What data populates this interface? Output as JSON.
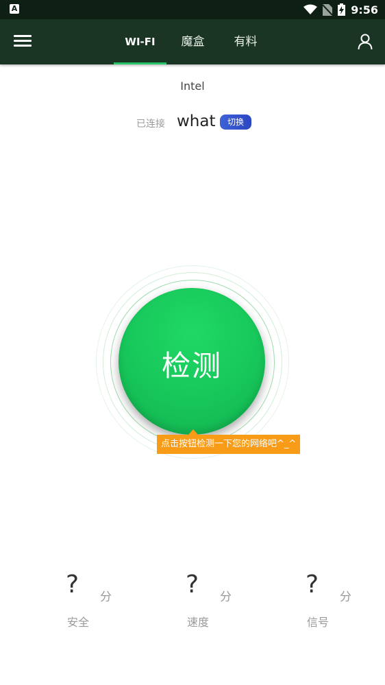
{
  "status_bar": {
    "time": "9:56",
    "left_icon": "A",
    "icons": [
      "wifi-icon",
      "no-sim-icon",
      "battery-charging-icon"
    ]
  },
  "app_bar": {
    "tabs": [
      {
        "label": "WI-FI",
        "active": true
      },
      {
        "label": "魔盒",
        "active": false
      },
      {
        "label": "有料",
        "active": false
      }
    ],
    "left_icon": "menu-icon",
    "right_icon": "user-icon"
  },
  "header": {
    "brand": "Intel",
    "connection_status": "已连接",
    "ssid": "what",
    "switch_label": "切换"
  },
  "detect": {
    "button_label": "检测",
    "tooltip": "点击按钮检测一下您的网络吧^_^"
  },
  "scores": [
    {
      "value": "?",
      "unit": "分",
      "label": "安全"
    },
    {
      "value": "?",
      "unit": "分",
      "label": "速度"
    },
    {
      "value": "?",
      "unit": "分",
      "label": "信号"
    }
  ],
  "colors": {
    "app_bar": "#1a3524",
    "status_bar": "#0e1f14",
    "accent_green": "#17c65a",
    "tab_indicator": "#28c26a",
    "tooltip": "#f89b17",
    "switch_button": "#3d62d6"
  }
}
